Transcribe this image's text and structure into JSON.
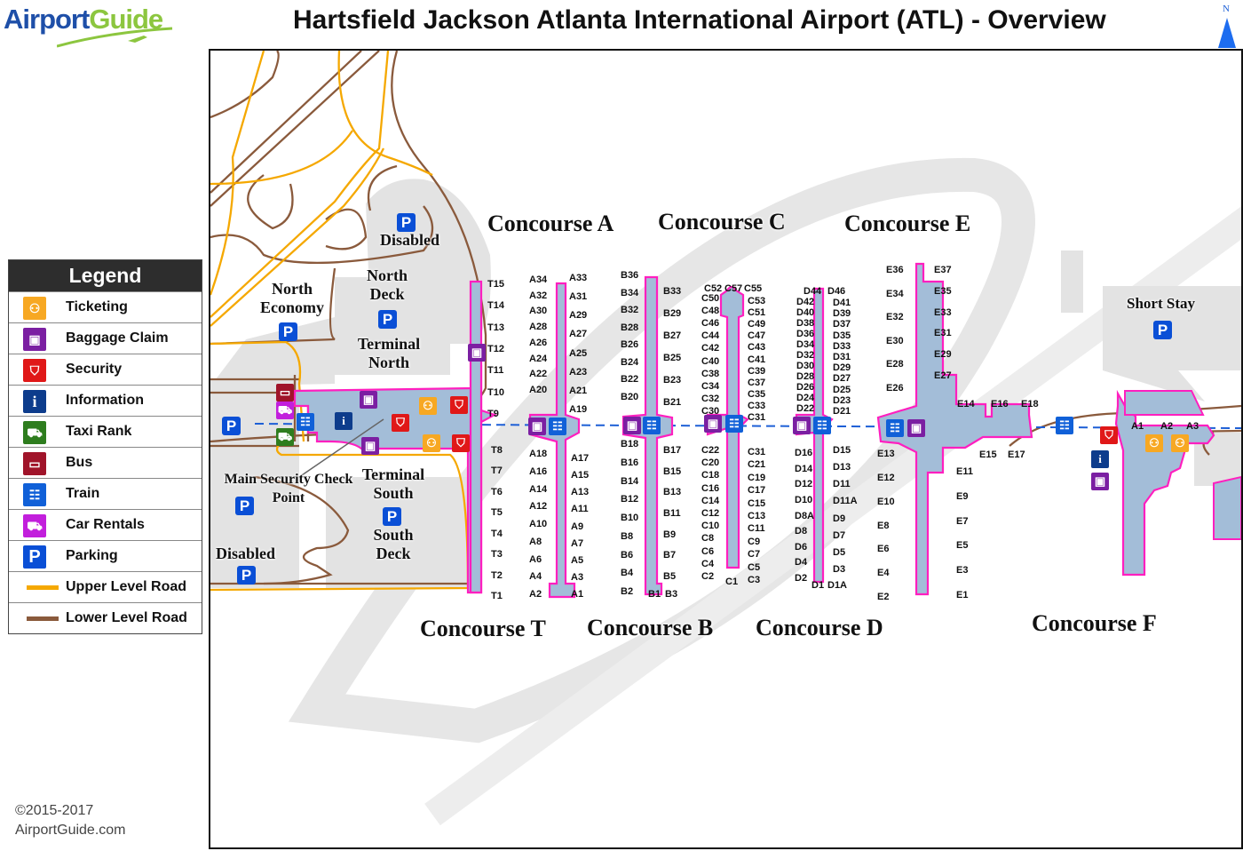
{
  "header": {
    "logo_part1": "Airport",
    "logo_part2": "Guide",
    "title": "Hartsfield Jackson Atlanta International Airport (ATL) - Overview",
    "north_label": "N"
  },
  "legend": {
    "title": "Legend",
    "items": [
      {
        "label": "Ticketing",
        "icon": "ticketing-icon",
        "color": "#f7a823",
        "glyph": "⚇"
      },
      {
        "label": "Baggage Claim",
        "icon": "baggage-claim-icon",
        "color": "#7b1fa2",
        "glyph": "▣"
      },
      {
        "label": "Security",
        "icon": "security-icon",
        "color": "#e01818",
        "glyph": "⛉"
      },
      {
        "label": "Information",
        "icon": "information-icon",
        "color": "#0d3c8c",
        "glyph": "i"
      },
      {
        "label": "Taxi Rank",
        "icon": "taxi-icon",
        "color": "#2e7d1e",
        "glyph": "⛟"
      },
      {
        "label": "Bus",
        "icon": "bus-icon",
        "color": "#a0142a",
        "glyph": "▭"
      },
      {
        "label": "Train",
        "icon": "train-icon",
        "color": "#1060d8",
        "glyph": "☷"
      },
      {
        "label": "Car Rentals",
        "icon": "car-rental-icon",
        "color": "#c21fdc",
        "glyph": "⛟"
      },
      {
        "label": "Parking",
        "icon": "parking-icon",
        "color": "#0a4fd6",
        "glyph": "P"
      },
      {
        "label": "Upper Level Road",
        "icon": "upper-level-road-line",
        "color": "#f5a800"
      },
      {
        "label": "Lower Level  Road",
        "icon": "lower-level-road-line",
        "color": "#8a5a3c"
      }
    ]
  },
  "footer": {
    "copyright": "©2015-2017",
    "site": "AirportGuide.com"
  },
  "colors": {
    "concourse_fill": "#a3bdd8",
    "concourse_border": "#ff1fbf",
    "parking_area": "#e3e3e3",
    "upper_road": "#f5a800",
    "lower_road": "#8a5a3c",
    "train_line": "#1d5fd6"
  },
  "map": {
    "concourse_labels": {
      "A": "Concourse A",
      "B": "Concourse B",
      "C": "Concourse C",
      "D": "Concourse D",
      "E": "Concourse E",
      "F": "Concourse F",
      "T": "Concourse T"
    },
    "place_labels": {
      "disabled_north": "Disabled",
      "north_deck": "North Deck",
      "north_economy": "North Economy",
      "terminal_north": "Terminal North",
      "main_security": "Main Security Check Point",
      "terminal_south": "Terminal South",
      "south_deck": "South Deck",
      "disabled_south": "Disabled",
      "short_stay": "Short Stay"
    },
    "parking_glyph": "P",
    "intl_gates": [
      "A1",
      "A2",
      "A3"
    ],
    "gates": {
      "T": [
        "T15",
        "T14",
        "T13",
        "T12",
        "T11",
        "T10",
        "T9",
        "T8",
        "T7",
        "T6",
        "T5",
        "T4",
        "T3",
        "T2",
        "T1"
      ],
      "A_left": [
        "A34",
        "A32",
        "A30",
        "A28",
        "A26",
        "A24",
        "A22",
        "A20",
        "A18",
        "A16",
        "A14",
        "A12",
        "A10",
        "A8",
        "A6",
        "A4",
        "A2"
      ],
      "A_right": [
        "A33",
        "A31",
        "A29",
        "A27",
        "A25",
        "A23",
        "A21",
        "A19",
        "A17",
        "A15",
        "A13",
        "A11",
        "A9",
        "A7",
        "A5",
        "A3",
        "A1"
      ],
      "B_left": [
        "B36",
        "B34",
        "B32",
        "B28",
        "B26",
        "B24",
        "B22",
        "B20",
        "B18",
        "B16",
        "B14",
        "B12",
        "B10",
        "B8",
        "B6",
        "B4",
        "B2"
      ],
      "B_right": [
        "B33",
        "B29",
        "B27",
        "B25",
        "B23",
        "B21",
        "B17",
        "B15",
        "B13",
        "B11",
        "B9",
        "B7",
        "B5",
        "B3"
      ],
      "B_bottom": "B1",
      "C_top": [
        "C52",
        "C57",
        "C55"
      ],
      "C_left": [
        "C50",
        "C48",
        "C46",
        "C44",
        "C42",
        "C40",
        "C38",
        "C34",
        "C32",
        "C30",
        "C22",
        "C20",
        "C18",
        "C16",
        "C14",
        "C12",
        "C10",
        "C8",
        "C6",
        "C4",
        "C2"
      ],
      "C_right": [
        "C53",
        "C51",
        "C49",
        "C47",
        "C43",
        "C41",
        "C39",
        "C37",
        "C35",
        "C33",
        "C31",
        "C21",
        "C19",
        "C17",
        "C15",
        "C13",
        "C11",
        "C9",
        "C7",
        "C5",
        "C3"
      ],
      "C_bottom": "C1",
      "D_top": [
        "D44",
        "D46"
      ],
      "D_left": [
        "D42",
        "D40",
        "D38",
        "D36",
        "D34",
        "D32",
        "D30",
        "D28",
        "D26",
        "D24",
        "D22",
        "D16",
        "D14",
        "D12",
        "D10",
        "D8A",
        "D8",
        "D6",
        "D4",
        "D2"
      ],
      "D_right": [
        "D41",
        "D39",
        "D37",
        "D35",
        "D33",
        "D31",
        "D29",
        "D27",
        "D25",
        "D23",
        "D21",
        "D15",
        "D13",
        "D11",
        "D11A",
        "D9",
        "D7",
        "D5",
        "D3"
      ],
      "D_bottom": [
        "D1",
        "D1A"
      ],
      "E_left": [
        "E36",
        "E34",
        "E32",
        "E30",
        "E28",
        "E26",
        "E13",
        "E12",
        "E10",
        "E8",
        "E6",
        "E4",
        "E2"
      ],
      "E_right": [
        "E37",
        "E35",
        "E33",
        "E31",
        "E29",
        "E27",
        "E11",
        "E9",
        "E7",
        "E5",
        "E3",
        "E1"
      ],
      "E_branch": [
        "E14",
        "E16",
        "E18",
        "E15",
        "E17"
      ]
    }
  }
}
